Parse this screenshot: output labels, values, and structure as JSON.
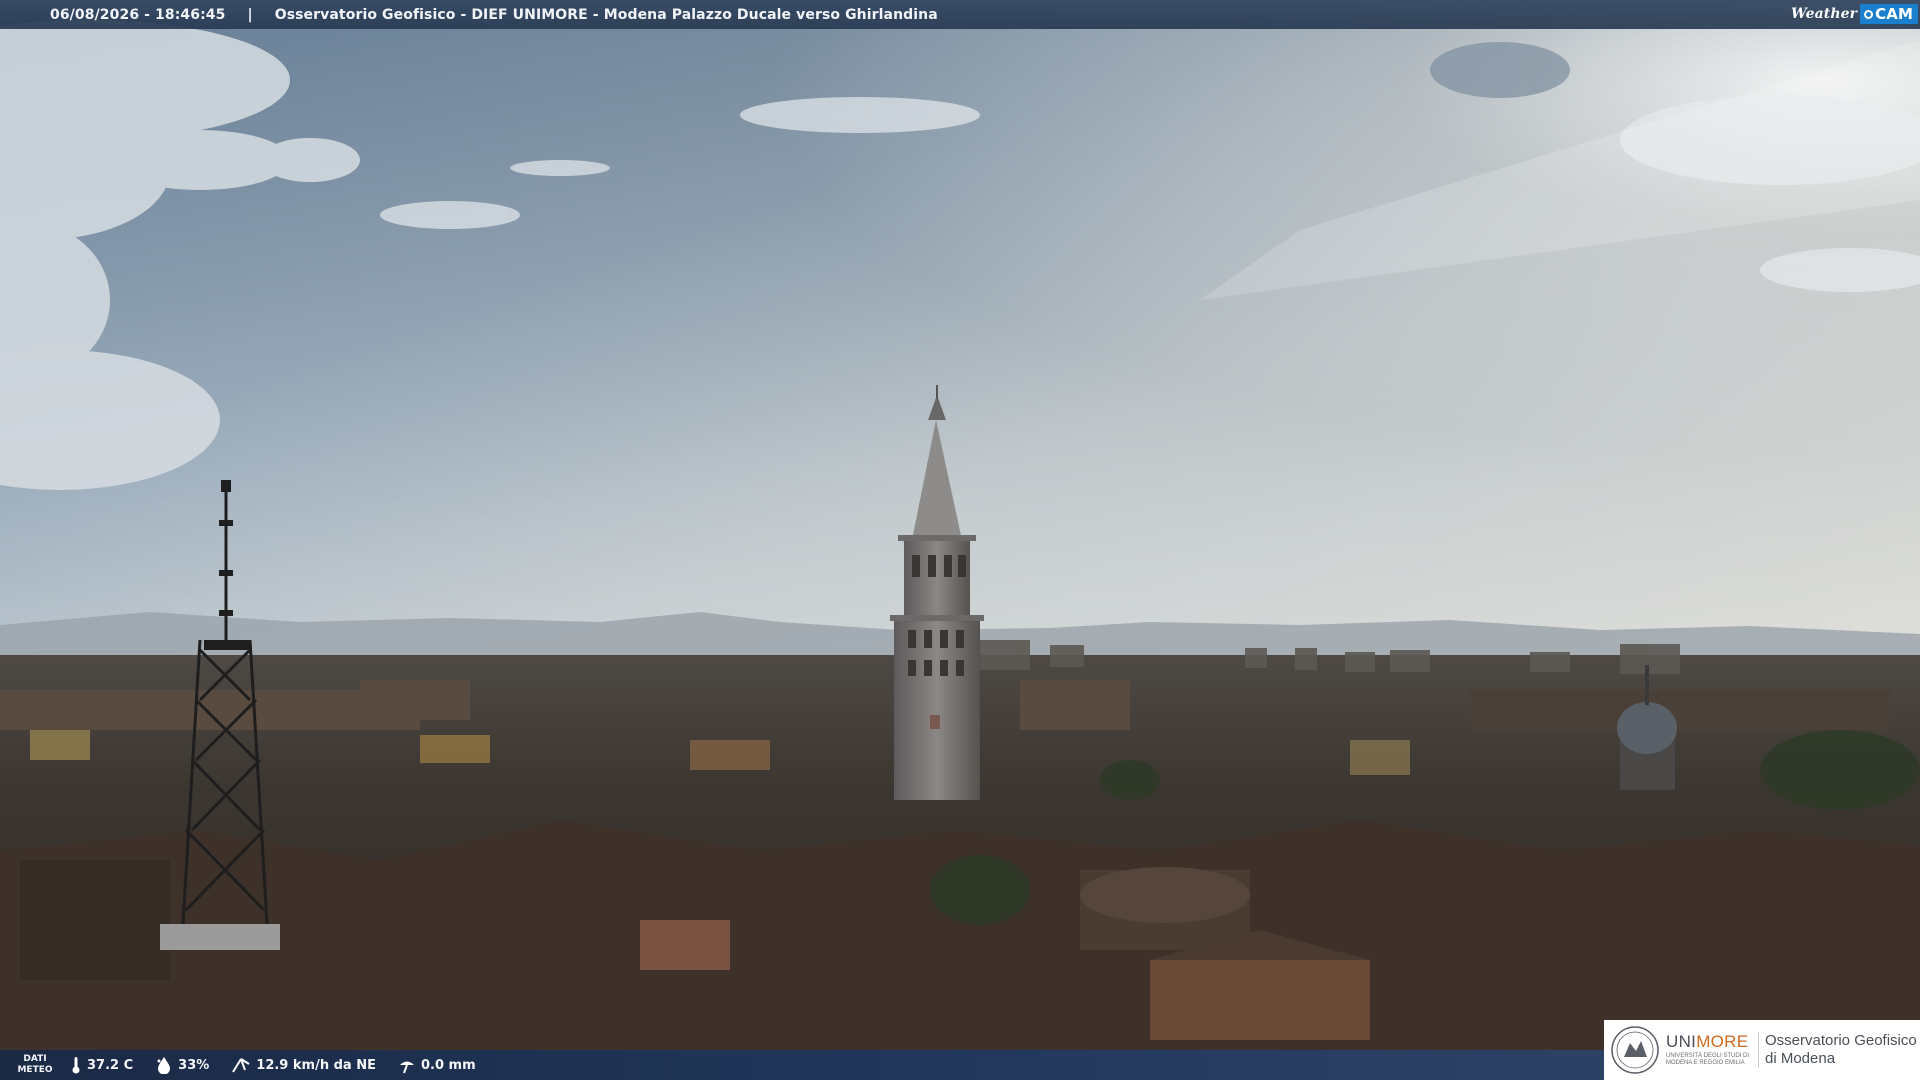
{
  "header": {
    "timestamp": "06/08/2026 - 18:46:45",
    "separator": "|",
    "title": "Osservatorio Geofisico - DIEF UNIMORE - Modena Palazzo Ducale verso Ghirlandina"
  },
  "brand": {
    "weather_text": "Weather",
    "cam_text": "CAM"
  },
  "weather_bar": {
    "label_line1": "DATI",
    "label_line2": "METEO",
    "temperature": "37.2 C",
    "humidity": "33%",
    "wind": "12.9 km/h da NE",
    "rain": "0.0 mm",
    "icons": [
      "thermometer-icon",
      "humidity-drop-icon",
      "wind-icon",
      "rain-gauge-icon"
    ]
  },
  "institution": {
    "name_part1": "UNI",
    "name_part2": "MORE",
    "subtitle_line1": "UNIVERSITÀ DEGLI STUDI DI",
    "subtitle_line2": "MODENA E REGGIO EMILIA",
    "observatory_line1": "Osservatorio Geofisico",
    "observatory_line2": "di Modena"
  },
  "colors": {
    "topbar": "#34485e",
    "brand_blue": "#1b7fd0",
    "unimore_orange": "#d2691e",
    "unimore_grey": "#4a4f58"
  }
}
